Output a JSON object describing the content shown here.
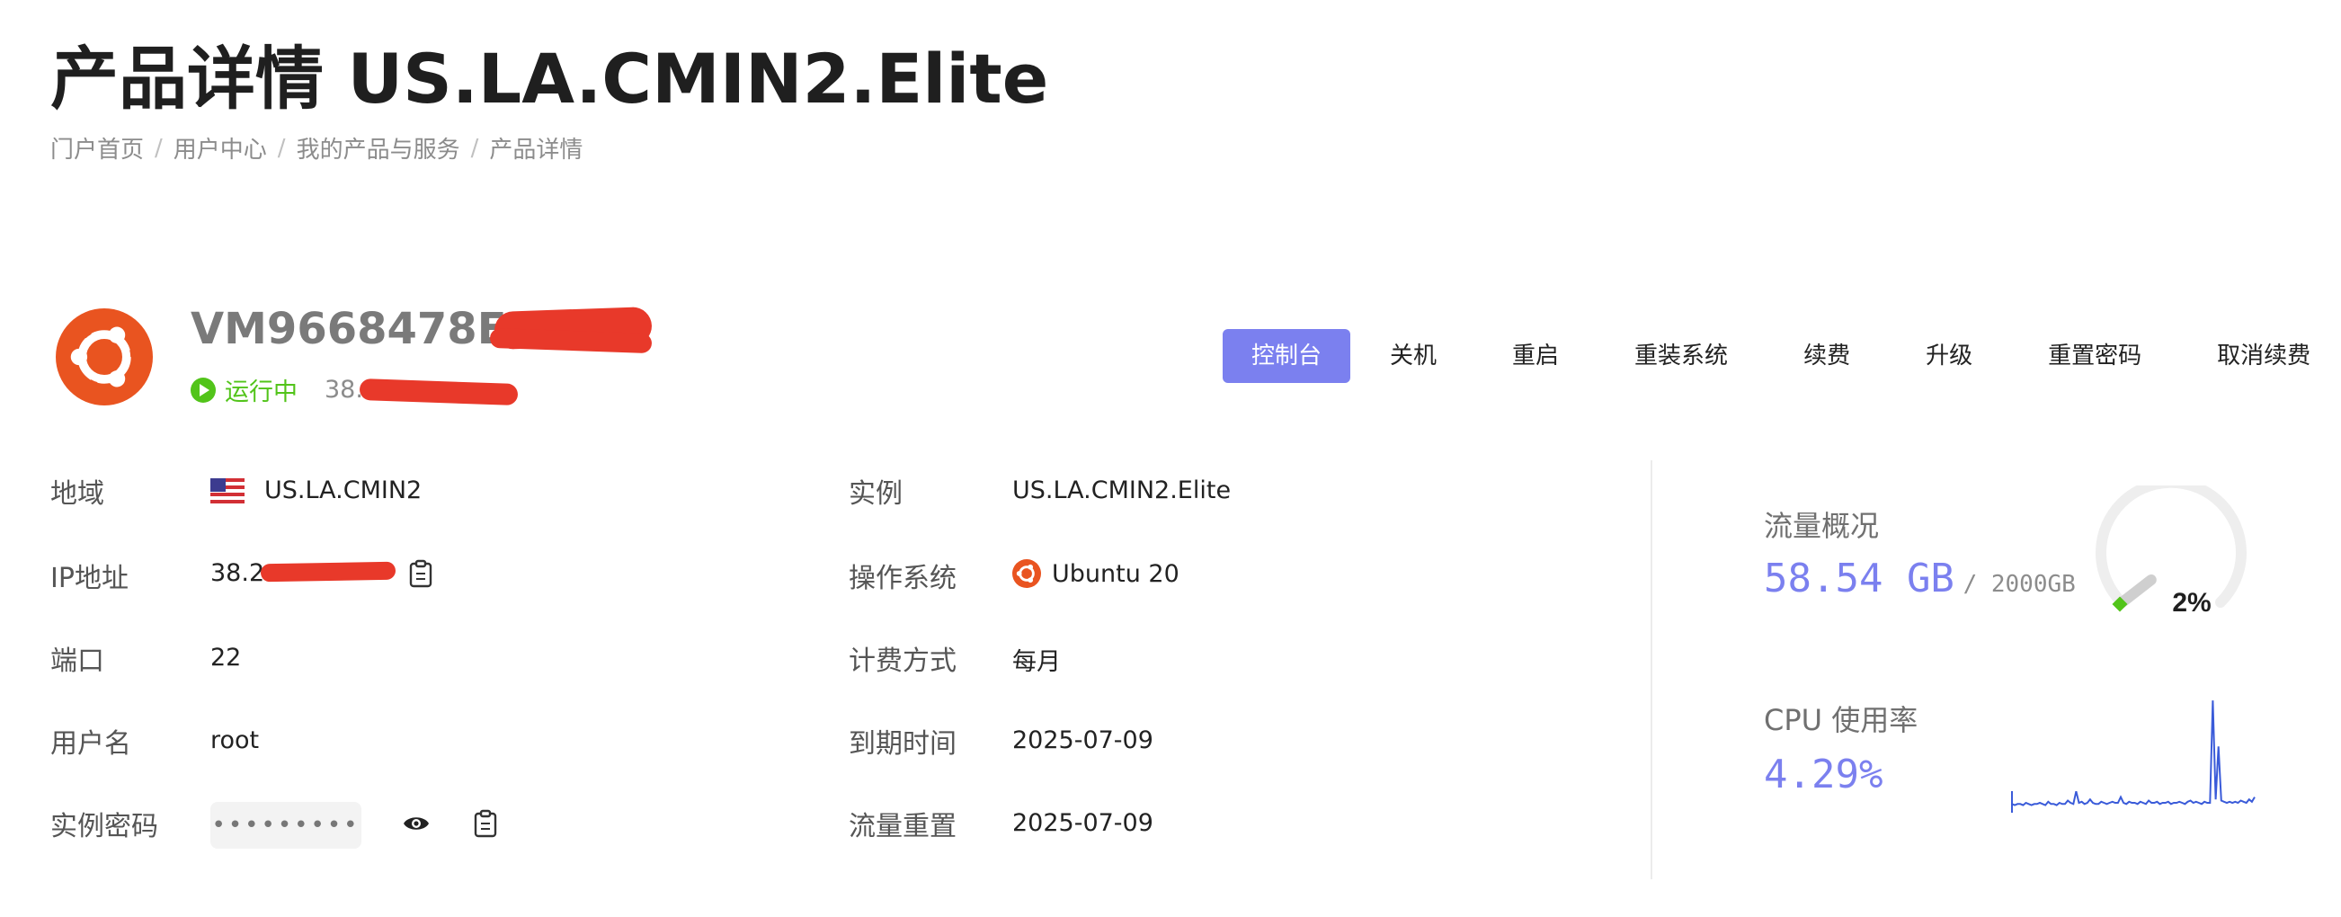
{
  "page": {
    "title": "产品详情 US.LA.CMIN2.Elite"
  },
  "breadcrumb": [
    "门户首页",
    "用户中心",
    "我的产品与服务",
    "产品详情"
  ],
  "instance": {
    "name": "VM9668478EAC",
    "status": "运行中",
    "ip_partial": "38.",
    "os_icon": "ubuntu-logo-icon"
  },
  "toolbar": [
    "控制台",
    "关机",
    "重启",
    "重装系统",
    "续费",
    "升级",
    "重置密码",
    "取消续费"
  ],
  "info_left": {
    "region_label": "地域",
    "region_value": "US.LA.CMIN2",
    "ip_label": "IP地址",
    "ip_value": "38.2",
    "port_label": "端口",
    "port_value": "22",
    "user_label": "用户名",
    "user_value": "root",
    "password_label": "实例密码",
    "password_value": "•••••••••"
  },
  "info_right": {
    "instance_label": "实例",
    "instance_value": "US.LA.CMIN2.Elite",
    "os_label": "操作系统",
    "os_value": "Ubuntu 20",
    "billing_label": "计费方式",
    "billing_value": "每月",
    "expiry_label": "到期时间",
    "expiry_value": "2025-07-09",
    "reset_label": "流量重置",
    "reset_value": "2025-07-09"
  },
  "traffic": {
    "title": "流量概况",
    "used": "58.54 GB",
    "total": "/ 2000GB",
    "percent_label": "2%",
    "percent": 0.02
  },
  "cpu": {
    "title": "CPU 使用率",
    "value": "4.29%",
    "samples": [
      0.06,
      0.05,
      0.06,
      0.06,
      0.05,
      0.07,
      0.06,
      0.05,
      0.06,
      0.06,
      0.07,
      0.06,
      0.05,
      0.08,
      0.06,
      0.06,
      0.05,
      0.07,
      0.06,
      0.06,
      0.09,
      0.07,
      0.06,
      0.17,
      0.07,
      0.08,
      0.06,
      0.07,
      0.1,
      0.07,
      0.06,
      0.06,
      0.08,
      0.07,
      0.06,
      0.07,
      0.08,
      0.07,
      0.07,
      0.12,
      0.07,
      0.06,
      0.08,
      0.07,
      0.07,
      0.06,
      0.08,
      0.07,
      0.06,
      0.09,
      0.07,
      0.07,
      0.08,
      0.06,
      0.07,
      0.07,
      0.08,
      0.06,
      0.07,
      0.07,
      0.08,
      0.07,
      0.06,
      0.08,
      0.09,
      0.07,
      0.08,
      0.07,
      0.06,
      0.08,
      0.07,
      0.07,
      0.96,
      0.1,
      0.56,
      0.09,
      0.08,
      0.07,
      0.08,
      0.07,
      0.08,
      0.07,
      0.09,
      0.08,
      0.07,
      0.1,
      0.08,
      0.12
    ]
  },
  "colors": {
    "accent": "#7b80ef",
    "running": "#52c41a",
    "ubuntu": "#e95420",
    "spark_line": "#3a5bd9"
  }
}
